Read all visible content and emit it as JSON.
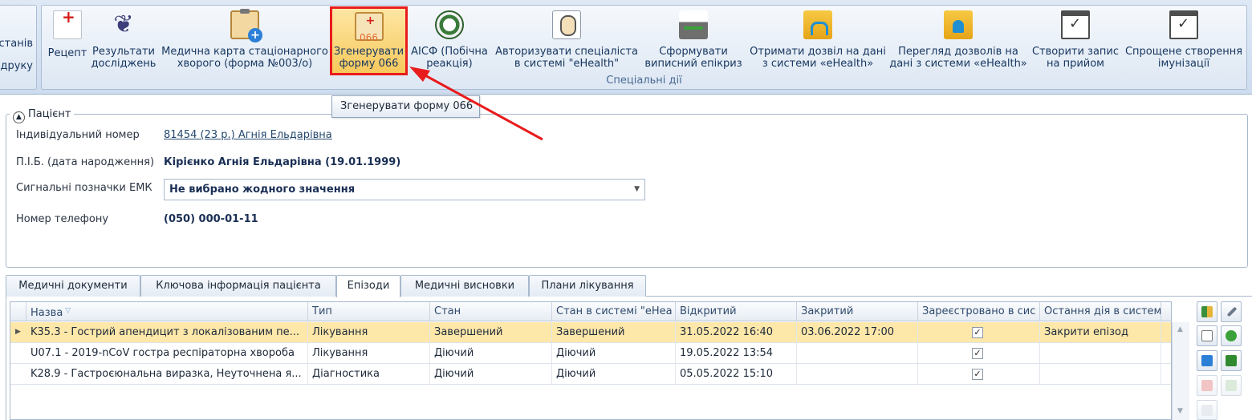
{
  "ribbon": {
    "left_labels": [
      "станів",
      "друку"
    ],
    "group_caption": "Спеціальні дії",
    "buttons": [
      {
        "id": "recipe",
        "label": "Рецепт",
        "icon": "prescription-doc-icon"
      },
      {
        "id": "results",
        "label": "Результати\nдосліджень",
        "icon": "lungs-icon"
      },
      {
        "id": "inpatient_card",
        "label": "Медична карта стаціонарного\nхворого (форма №003/о)",
        "icon": "medical-clipboard-icon"
      },
      {
        "id": "form066",
        "label": "Згенерувати\nформу 066",
        "icon": "form-066-icon"
      },
      {
        "id": "aisf",
        "label": "АІСФ (Побічна\nреакція)",
        "icon": "aisf-emblem-icon"
      },
      {
        "id": "authorize",
        "label": "Авторизувати спеціаліста\nв системі \"eHealth\"",
        "icon": "specialist-avatar-icon"
      },
      {
        "id": "epicrisis",
        "label": "Сформувати\nвиписний епікриз",
        "icon": "printer-icon"
      },
      {
        "id": "get_permission",
        "label": "Отримати дозвіл на дані\nз системи «eHealth»",
        "icon": "folder-unlock-icon"
      },
      {
        "id": "view_permissions",
        "label": "Перегляд дозволів на\nдані з системи «eHealth»",
        "icon": "folder-lock-icon"
      },
      {
        "id": "appointment",
        "label": "Створити запис\nна прийом",
        "icon": "calendar-check-icon"
      },
      {
        "id": "immunization",
        "label": "Спрощене створення\nімунізації",
        "icon": "calendar-check-icon"
      }
    ]
  },
  "tooltip": "Згенерувати форму 066",
  "patient": {
    "legend": "Пацієнт",
    "id_label": "Індивідуальний номер",
    "id_value": "81454 (23 р.) Агнія Ельдарівна",
    "name_label": "П.І.Б. (дата народження)",
    "name_value": "Кірієнко Агнія Ельдарівна (19.01.1999)",
    "emk_label": "Сигнальні позначки ЕМК",
    "emk_value": "Не вибрано жодного значення",
    "phone_label": "Номер телефону",
    "phone_value": "(050) 000-01-11"
  },
  "tabs": [
    "Медичні документи",
    "Ключова інформація пацієнта",
    "Епізоди",
    "Медичні висновки",
    "Плани лікування"
  ],
  "active_tab": "Епізоди",
  "grid": {
    "columns": [
      "Назва",
      "Тип",
      "Стан",
      "Стан в системі \"eHea",
      "Відкритий",
      "Закритий",
      "Зареєстровано в сис",
      "Остання дія в систем"
    ],
    "rows": [
      [
        "K35.3 - Гострий апендицит з локалізованим пе...",
        "Лікування",
        "Завершений",
        "Завершений",
        "31.05.2022 16:40",
        "03.06.2022 17:00",
        "✓",
        "Закрити епізод"
      ],
      [
        "U07.1 - 2019-nCoV гостра респіраторна хвороба",
        "Лікування",
        "Діючий",
        "Діючий",
        "19.05.2022 13:54",
        "",
        "✓",
        ""
      ],
      [
        "K28.9 - Гастроєюнальна виразка, Неуточнена я...",
        "Діагностика",
        "Діючий",
        "Діючий",
        "05.05.2022 15:10",
        "",
        "✓",
        ""
      ]
    ],
    "selected_row": 0
  },
  "colors": {
    "highlight_border": "#e81c1c",
    "selected_row": "#fde7a9",
    "ribbon_bg": "#dfe9f5"
  }
}
